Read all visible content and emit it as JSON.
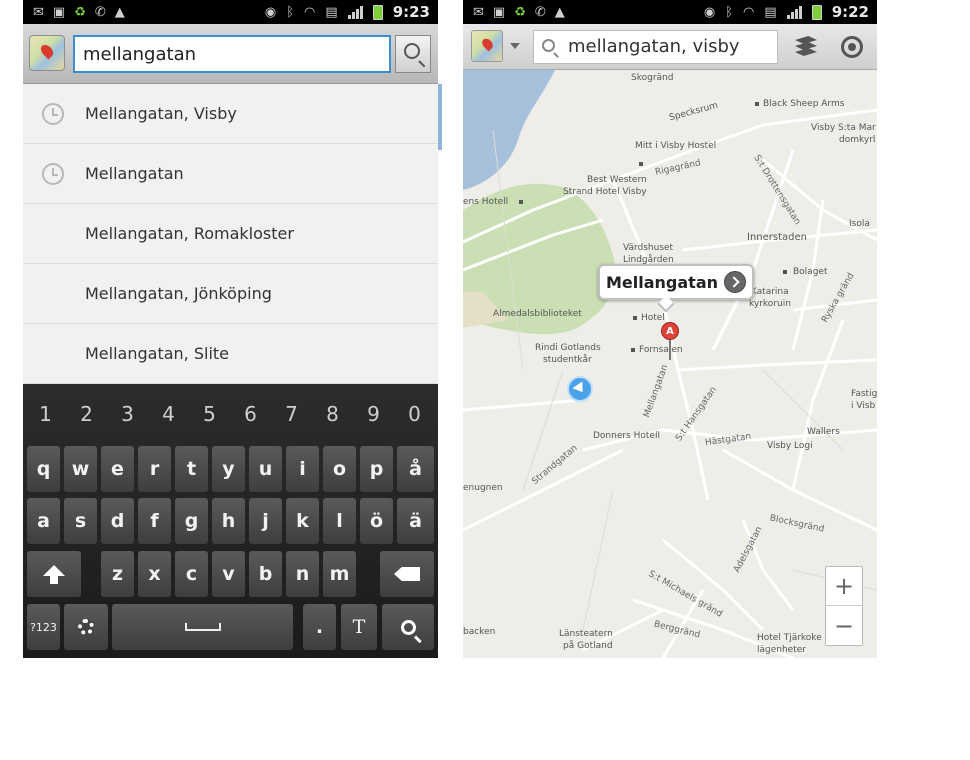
{
  "left_phone": {
    "status": {
      "time": "9:23"
    },
    "search": {
      "query": "mellangatan"
    },
    "suggestions": [
      {
        "label": "Mellangatan, Visby",
        "history": true
      },
      {
        "label": "Mellangatan",
        "history": true
      },
      {
        "label": "Mellangatan, Romakloster",
        "history": false
      },
      {
        "label": "Mellangatan, Jönköping",
        "history": false
      },
      {
        "label": "Mellangatan, Slite",
        "history": false
      }
    ],
    "keyboard": {
      "numbers": [
        "1",
        "2",
        "3",
        "4",
        "5",
        "6",
        "7",
        "8",
        "9",
        "0"
      ],
      "row1": [
        "q",
        "w",
        "e",
        "r",
        "t",
        "y",
        "u",
        "i",
        "o",
        "p",
        "å"
      ],
      "row2": [
        "a",
        "s",
        "d",
        "f",
        "g",
        "h",
        "j",
        "k",
        "l",
        "ö",
        "ä"
      ],
      "row3": [
        "z",
        "x",
        "c",
        "v",
        "b",
        "n",
        "m"
      ],
      "symbols_label": "?123",
      "period": ".",
      "text_style_label": "T",
      "icons": {
        "shift": "shift-arrow-icon",
        "backspace": "backspace-icon",
        "settings": "gear-icon",
        "space": "space-bar-icon",
        "search": "search-icon"
      }
    }
  },
  "right_phone": {
    "status": {
      "time": "9:22"
    },
    "toolbar": {
      "query": "mellangatan, visby",
      "icons": {
        "layers": "layers-icon",
        "my_location": "my-location-icon"
      }
    },
    "callout": {
      "title": "Mellangatan"
    },
    "pin": {
      "letter": "A"
    },
    "zoom": {
      "in": "+",
      "out": "−"
    },
    "map_labels": {
      "skogrand": "Skogränd",
      "specksrum": "Specksrum",
      "black_sheep": "Black Sheep Arms",
      "visby_sta_mar": "Visby S:ta Mar",
      "domkyr": "domkyrl",
      "mitt_i_visby": "Mitt i Visby Hostel",
      "st_drottensgatan": "S:t Drottensgatan",
      "rigagrand": "Rigagränd",
      "best_western_1": "Best Western",
      "best_western_2": "Strand Hotel Visby",
      "ens_hotell": "ens Hotell",
      "isola": "Isola",
      "innerstaden": "Innerstaden",
      "vardshuset": "Värdshuset",
      "lindgarden": "Lindgården",
      "bolaget": "Bolaget",
      "katarina_1": "ta Katarina",
      "katarina_2": "kyrkoruin",
      "ryska_grand": "Ryska gränd",
      "almedals": "Almedalsbiblioteket",
      "hotel": "Hotel",
      "rindi_1": "Rindi Gotlands",
      "rindi_2": "studentkår",
      "fornsalen": "Fornsalen",
      "mellangatan": "Mellangatan",
      "st_hansgatan": "S:t Hansgatan",
      "strandgatan": "Strandgatan",
      "donners": "Donners Hotell",
      "hastgatan": "Hästgatan",
      "visby_logi": "Visby Logi",
      "wallers": "Wallers",
      "fastig_1": "Fastig",
      "fastig_2": "i Visb",
      "enugnen": "enugnen",
      "blocksgrand": "Blocksgränd",
      "adelsgatan": "Adelsgatan",
      "st_michaels": "S:t Michaels gränd",
      "backen": "backen",
      "lansteatern_1": "Länsteatern",
      "lansteatern_2": "på Gotland",
      "berggrand": "Berggränd",
      "tjarkoke_1": "Hotel Tjärkoke",
      "tjarkoke_2": "lägenheter"
    }
  }
}
